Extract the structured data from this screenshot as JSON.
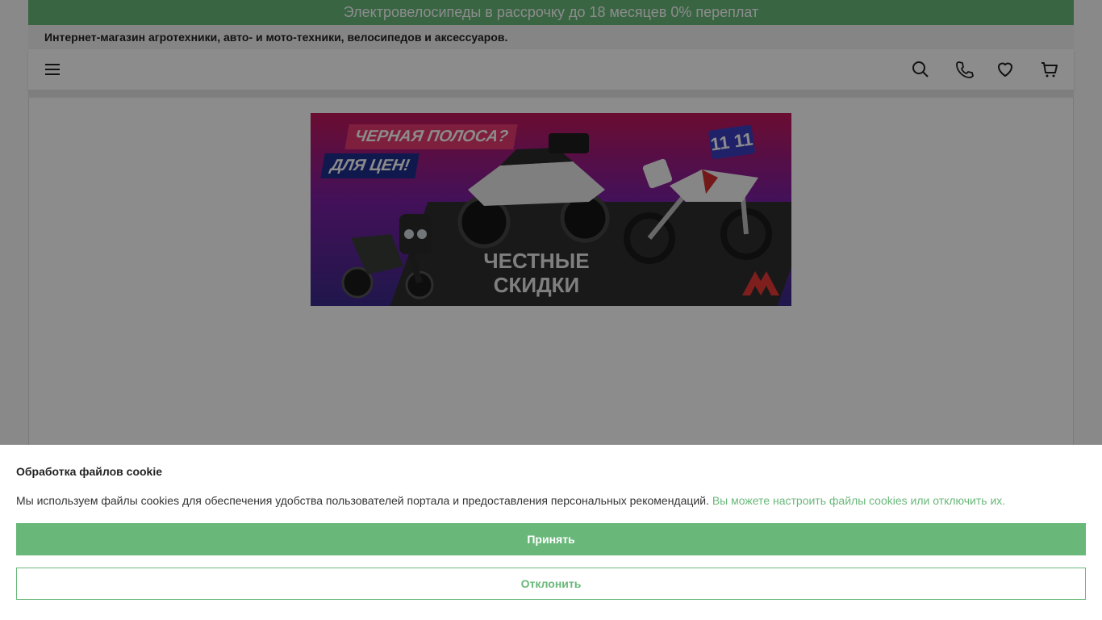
{
  "promo": {
    "text": "Электровелосипеды в рассрочку до 18 месяцев 0% переплат"
  },
  "header": {
    "tagline": "Интернет-магазин агротехники, авто- и мото-техники, велосипедов и аксессуаров."
  },
  "nav": {
    "icons": [
      "menu-icon",
      "search-icon",
      "phone-icon",
      "heart-icon",
      "cart-icon"
    ]
  },
  "banner": {
    "tag_line_1": "ЧЕРНАЯ ПОЛОСА?",
    "tag_line_2": "ДЛЯ ЦЕН!",
    "headline_1": "ЧЕСТНЫЕ",
    "headline_2": "СКИДКИ",
    "badge": "11 11"
  },
  "cookie": {
    "title": "Обработка файлов cookie",
    "text": "Мы используем файлы cookies для обеспечения удобства пользователей портала и предоставления персональных рекомендаций.",
    "link": "Вы можете настроить файлы cookies или отключить их.",
    "accept_label": "Принять",
    "decline_label": "Отклонить"
  },
  "colors": {
    "accent": "#69b87a",
    "overlay": "rgba(0,0,0,0.45)"
  }
}
